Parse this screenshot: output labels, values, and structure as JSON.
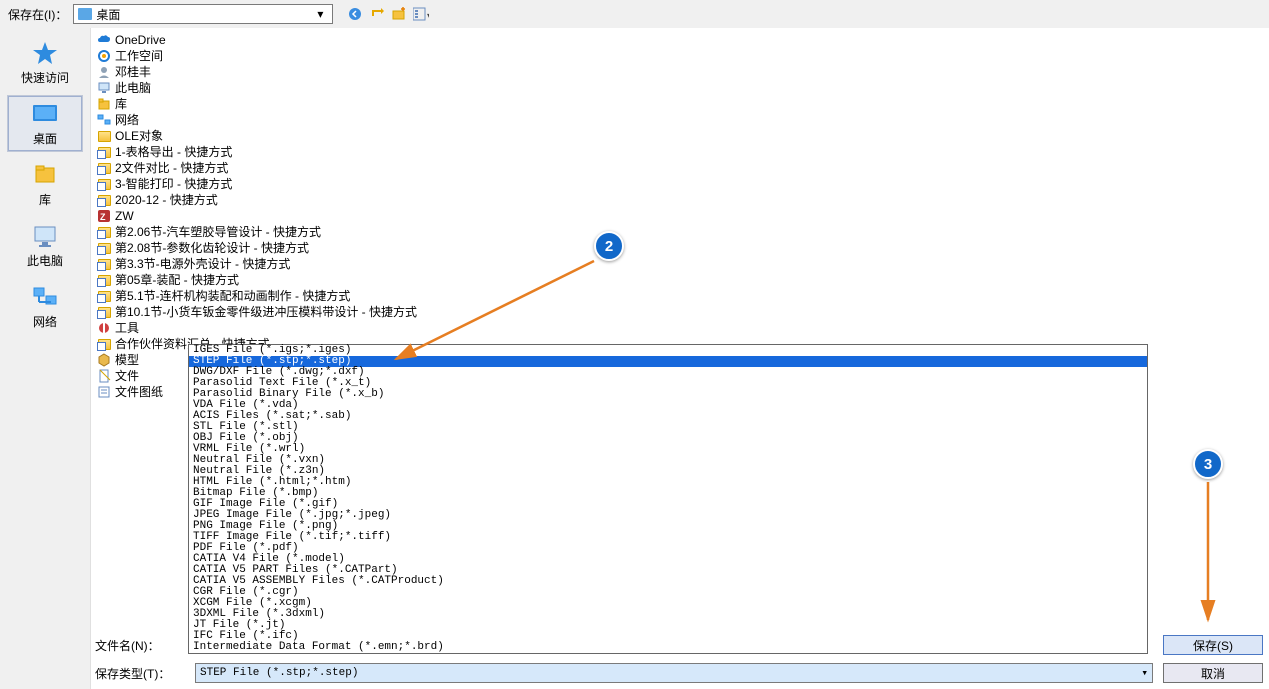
{
  "topbar": {
    "save_in_label": "保存在(I)：",
    "location_value": "桌面"
  },
  "sidebar": {
    "items": [
      {
        "label": "快速访问",
        "icon": "star"
      },
      {
        "label": "桌面",
        "icon": "desktop",
        "selected": true
      },
      {
        "label": "库",
        "icon": "library"
      },
      {
        "label": "此电脑",
        "icon": "thispc"
      },
      {
        "label": "网络",
        "icon": "network"
      }
    ]
  },
  "file_list": [
    {
      "icon": "onedrive",
      "label": "OneDrive"
    },
    {
      "icon": "workspace",
      "label": "工作空间"
    },
    {
      "icon": "user",
      "label": "邓桂丰"
    },
    {
      "icon": "thispc",
      "label": "此电脑"
    },
    {
      "icon": "library",
      "label": "库"
    },
    {
      "icon": "network",
      "label": "网络"
    },
    {
      "icon": "folder",
      "label": "OLE对象"
    },
    {
      "icon": "shortcut",
      "label": "1-表格导出 - 快捷方式"
    },
    {
      "icon": "shortcut",
      "label": "2文件对比 - 快捷方式"
    },
    {
      "icon": "shortcut",
      "label": "3-智能打印 - 快捷方式"
    },
    {
      "icon": "shortcut",
      "label": "2020-12 - 快捷方式"
    },
    {
      "icon": "zw",
      "label": "ZW"
    },
    {
      "icon": "shortcut",
      "label": "第2.06节-汽车塑胶导管设计 - 快捷方式"
    },
    {
      "icon": "shortcut",
      "label": "第2.08节-参数化齿轮设计 - 快捷方式"
    },
    {
      "icon": "shortcut",
      "label": "第3.3节-电源外壳设计 - 快捷方式"
    },
    {
      "icon": "shortcut",
      "label": "第05章-装配 - 快捷方式"
    },
    {
      "icon": "shortcut",
      "label": "第5.1节-连杆机构装配和动画制作 - 快捷方式"
    },
    {
      "icon": "shortcut",
      "label": "第10.1节-小货车钣金零件级进冲压模料带设计 - 快捷方式"
    },
    {
      "icon": "tool",
      "label": "工具"
    },
    {
      "icon": "shortcut",
      "label": "合作伙伴资料汇总 - 快捷方式"
    },
    {
      "icon": "model",
      "label": "模型"
    },
    {
      "icon": "file",
      "label": "文件"
    },
    {
      "icon": "drawing",
      "label": "文件图纸"
    }
  ],
  "filetype_options": [
    "IGES File (*.igs;*.iges)",
    "STEP File (*.stp;*.step)",
    "DWG/DXF File (*.dwg;*.dxf)",
    "Parasolid Text File (*.x_t)",
    "Parasolid Binary File (*.x_b)",
    "VDA File (*.vda)",
    "ACIS Files (*.sat;*.sab)",
    "STL File (*.stl)",
    "OBJ File (*.obj)",
    "VRML File (*.wrl)",
    "Neutral File (*.vxn)",
    "Neutral File (*.z3n)",
    "HTML File (*.html;*.htm)",
    "Bitmap File (*.bmp)",
    "GIF Image File (*.gif)",
    "JPEG Image File (*.jpg;*.jpeg)",
    "PNG Image File (*.png)",
    "TIFF Image File (*.tif;*.tiff)",
    "PDF File (*.pdf)",
    "CATIA V4 File (*.model)",
    "CATIA V5 PART Files (*.CATPart)",
    "CATIA V5 ASSEMBLY Files (*.CATProduct)",
    "CGR File (*.cgr)",
    "XCGM File (*.xcgm)",
    "3DXML File (*.3dxml)",
    "JT File (*.jt)",
    "IFC File (*.ifc)",
    "Intermediate Data Format (*.emn;*.brd)"
  ],
  "filetype_selected_index": 1,
  "bottom": {
    "filename_label": "文件名(N)：",
    "filetype_label": "保存类型(T)：",
    "filetype_value": "STEP File (*.stp;*.step)",
    "save_button": "保存(S)",
    "cancel_button": "取消"
  },
  "annotations": {
    "badge2": "2",
    "badge3": "3"
  }
}
